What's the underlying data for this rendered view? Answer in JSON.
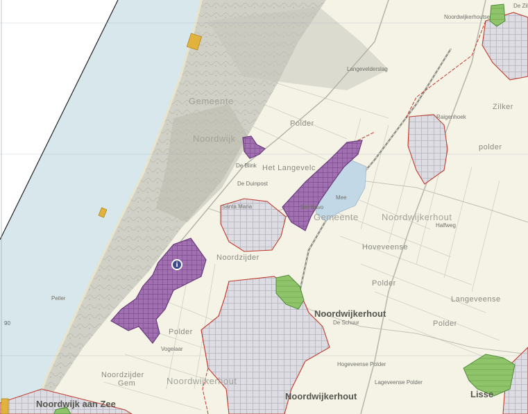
{
  "colors": {
    "sea": "#d7e7ec",
    "land": "#f4f3e6",
    "dunes": "#c9c9bf",
    "urban": "#d9d9de",
    "border": "#c0392b",
    "purple_fill": "#a070b0",
    "purple_stroke": "#6a3b7a",
    "green_fill": "#8fc46a",
    "green_stroke": "#4f8a3a",
    "water": "#c3d8e6",
    "beach_marker": "#e2b33c"
  },
  "icons": {
    "info_marker": "info-circle-icon"
  },
  "info_marker_label": "i",
  "labels": {
    "noordwijk_aan_zee": "Noordwijk aan Zee",
    "noordwijkerhout_1": "Noordwijkerhout",
    "noordwijkerhout_2": "Noordwijkerhout",
    "lisse": "Lisse",
    "gemeente_1": "Gemeente",
    "noordwijk_ghost": "Noordwijk",
    "gemeente_2": "Gemeente",
    "noordwijkerhout_ghost_1": "Noordwijkerhout",
    "noordwijkerhout_ghost_2": "Noordwijkerhout",
    "noordzijder": "Noordzijder",
    "polder_1": "Polder",
    "polder_2": "Polder",
    "polder_3": "Polder",
    "polder_4": "Polder",
    "polder_5": "polder",
    "hoveveense": "Hoveveense",
    "langeveense": "Langeveense",
    "het_langevelc": "Het Langevelc",
    "zilker": "Zilker",
    "gem": "Gem",
    "noordzijder_2": "Noordzijder",
    "grid_90": "90",
    "raigenhoek": "Raigenhoek",
    "de_zilk": "De Zilk",
    "santa_maria": "Santa Maria",
    "sint_bavo": "Sint Bavo",
    "de_blink": "De Blink",
    "de_duinpost": "De Duinpost",
    "mee": "Mee",
    "halfweg": "Halfweg",
    "de_schuur": "De Schuur",
    "langevelderslag": "Langevelderslag",
    "vogelaar": "Vogelaar",
    "noordwijkerhoutse": "Noordwijkerhoutse",
    "hogeveense_polder": "Hogeveense Polder",
    "lageveense_polder": "Lageveense Polder",
    "peiler": "Peiler"
  }
}
